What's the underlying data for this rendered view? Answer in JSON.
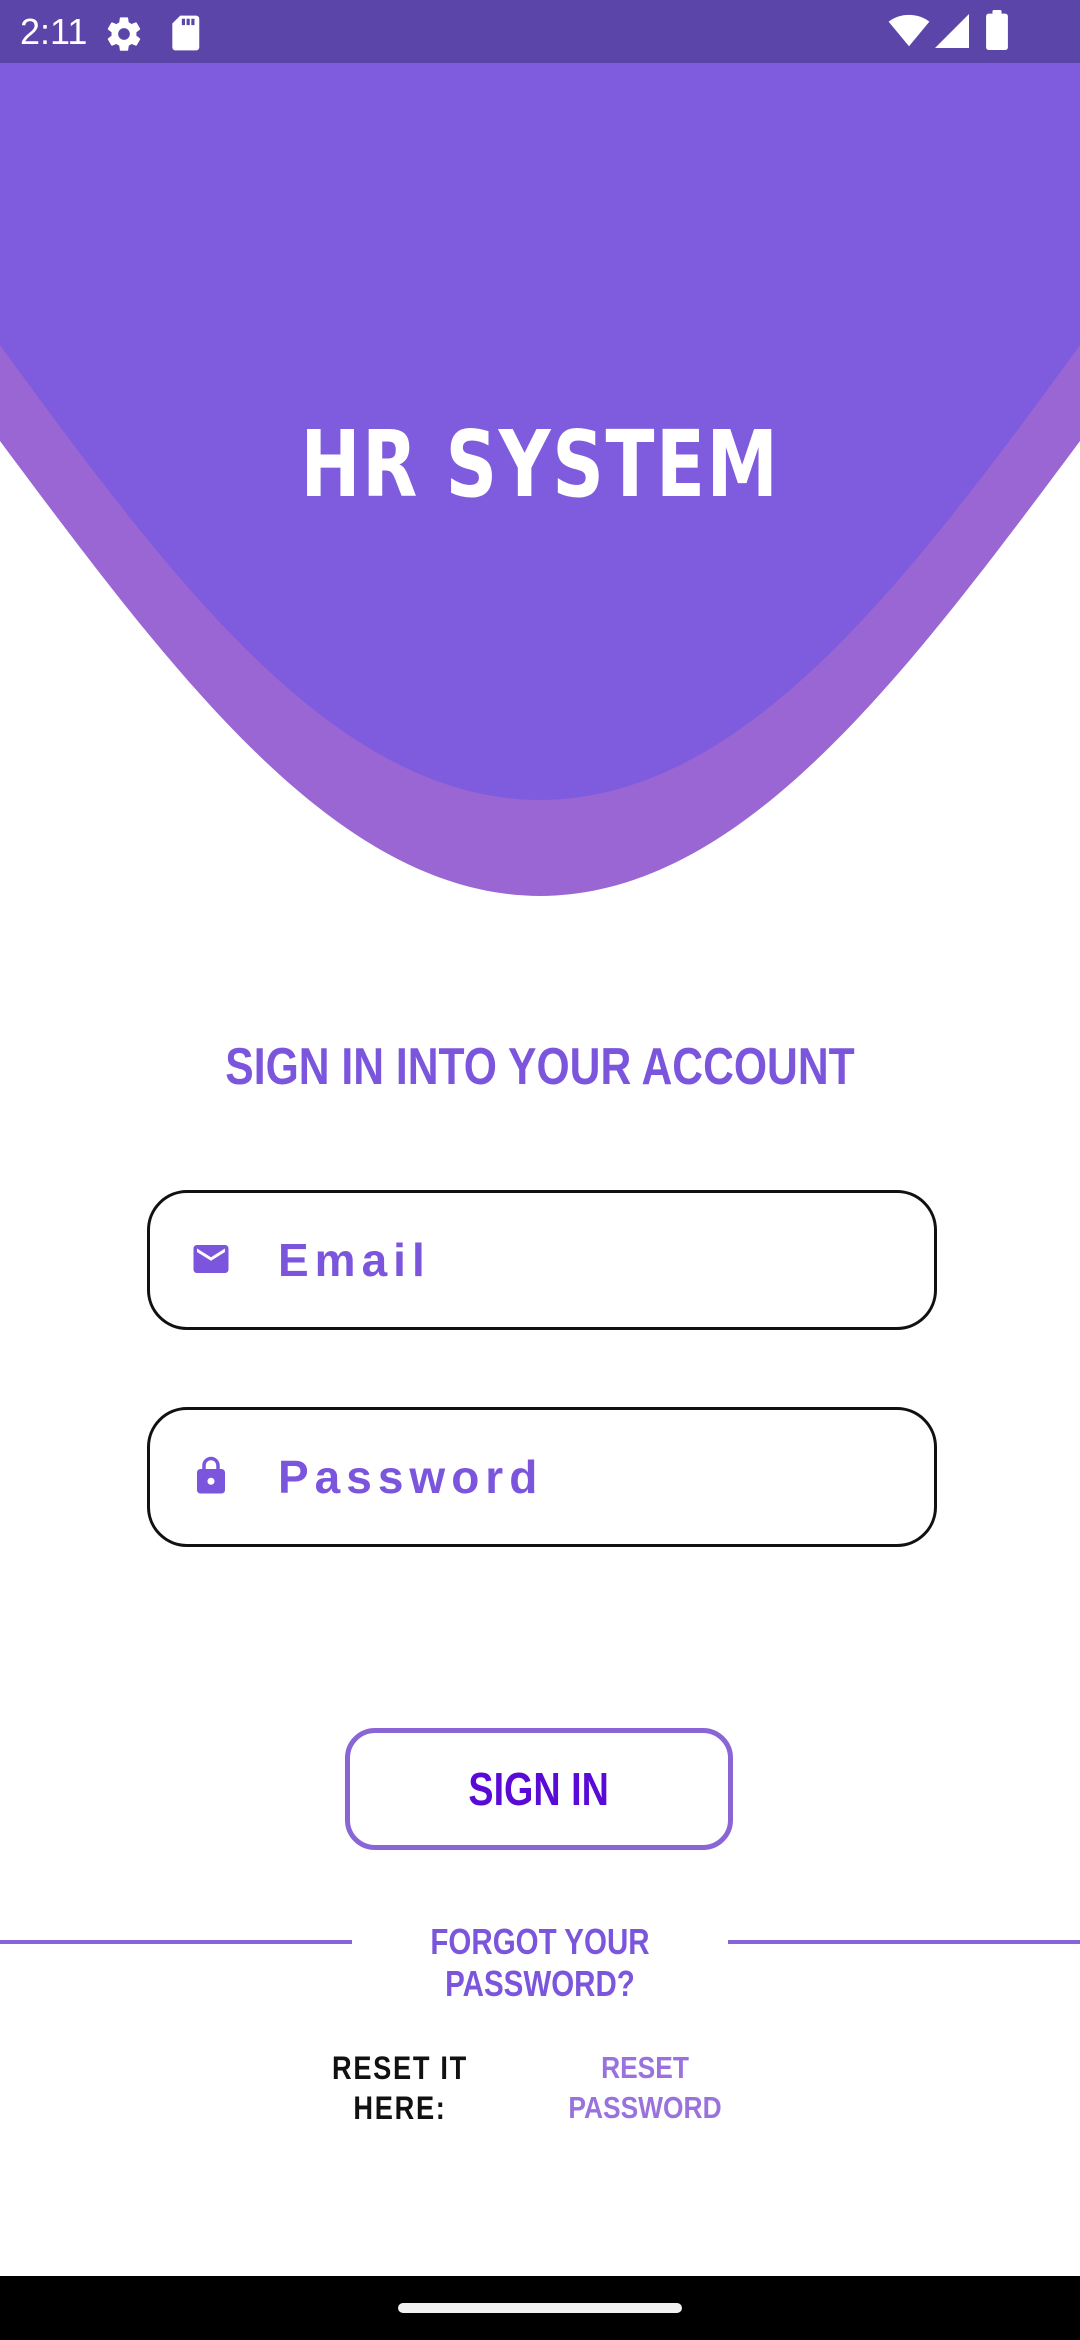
{
  "status_bar": {
    "time": "2:11",
    "icons": [
      "settings-gear-icon",
      "sd-card-icon",
      "wifi-icon",
      "cellular-signal-icon",
      "battery-icon"
    ]
  },
  "header": {
    "app_title": "HR SYSTEM"
  },
  "signin": {
    "heading": "SIGN IN INTO YOUR ACCOUNT",
    "email_placeholder": "Email",
    "password_placeholder": "Password",
    "button_label": "SIGN IN"
  },
  "forgot": {
    "text": "FORGOT YOUR PASSWORD?",
    "reset_label": "RESET IT HERE:",
    "reset_link": "RESET PASSWORD"
  },
  "colors": {
    "accent": "#7b56dd",
    "header_top": "#7f5bdd",
    "header_band": "#9966d4",
    "status_bar": "#5c45a8",
    "button_text": "#5a0ad6"
  }
}
